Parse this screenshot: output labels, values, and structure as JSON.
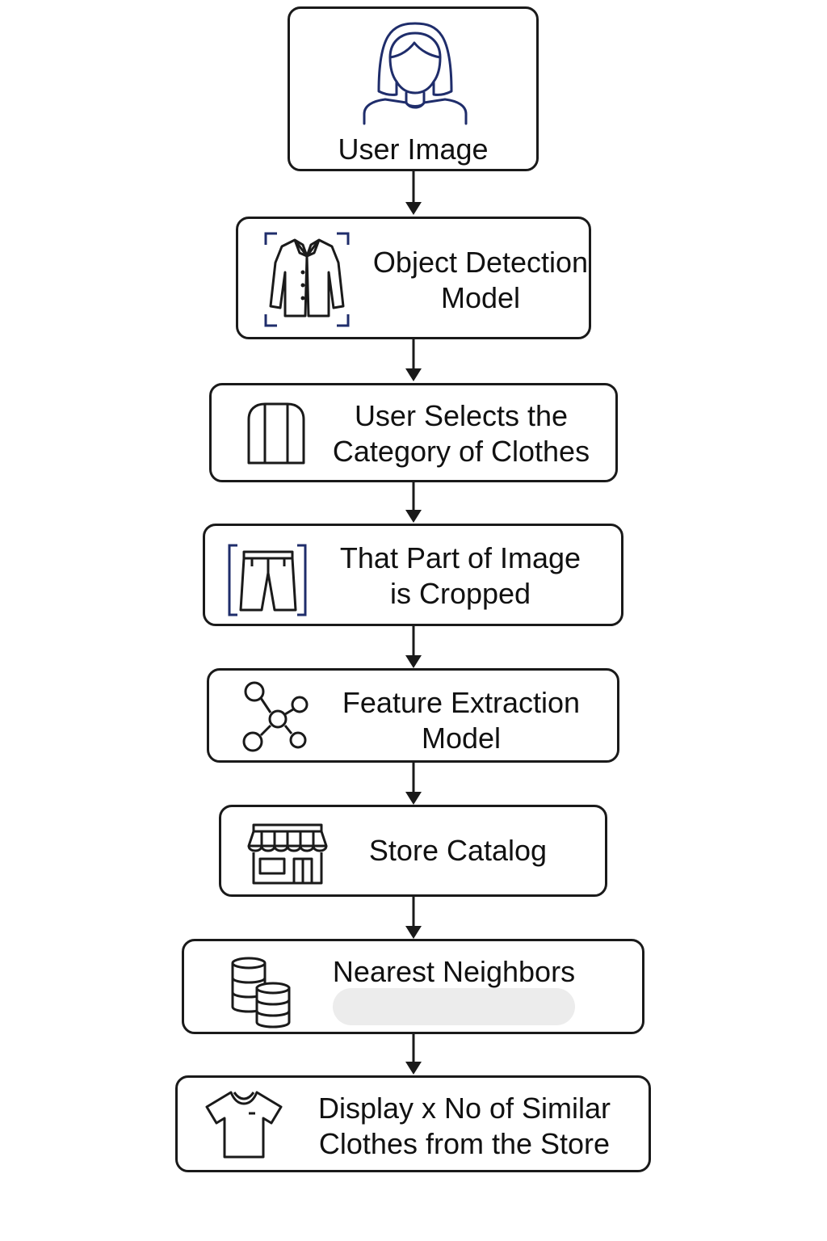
{
  "diagram": {
    "nodes": [
      {
        "id": "user-image",
        "icon": "user-icon",
        "lines": [
          "User Image"
        ]
      },
      {
        "id": "object-detection",
        "icon": "jacket-detection-icon",
        "lines": [
          "Object Detection",
          "Model"
        ]
      },
      {
        "id": "select-category",
        "icon": "cardigan-icon",
        "lines": [
          "User Selects the",
          "Category of Clothes"
        ]
      },
      {
        "id": "crop",
        "icon": "shorts-crop-icon",
        "lines": [
          "That Part of Image",
          "is Cropped"
        ]
      },
      {
        "id": "feature-extraction",
        "icon": "network-nodes-icon",
        "lines": [
          "Feature Extraction",
          "Model"
        ]
      },
      {
        "id": "store-catalog",
        "icon": "storefront-icon",
        "lines": [
          "Store Catalog"
        ]
      },
      {
        "id": "nearest-neighbors",
        "icon": "database-stack-icon",
        "lines": [
          "Nearest Neighbors"
        ]
      },
      {
        "id": "display",
        "icon": "tshirt-icon",
        "lines": [
          "Display x No of Similar",
          "Clothes from the Store"
        ]
      }
    ],
    "colors": {
      "stroke": "#1a1a1a",
      "accent": "#1f2d6b",
      "blur": "#ececec"
    }
  }
}
